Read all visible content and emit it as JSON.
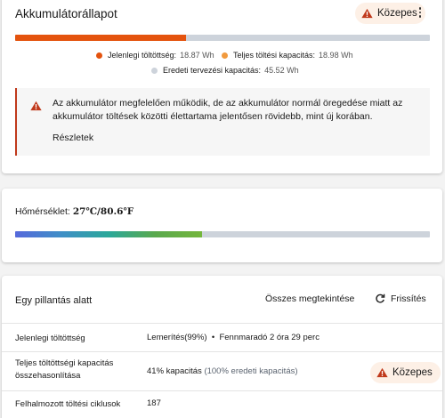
{
  "summary": {
    "title": "Akkumulátorállapot",
    "badge": "Közepes",
    "bar": {
      "level": 0.411,
      "fill_color": "#e4530e",
      "track_color": "#cdd3db"
    },
    "legend": [
      {
        "label": "Jelenlegi töltöttség:",
        "value": "18.87 Wh",
        "color": "#e4530e"
      },
      {
        "label": "Teljes töltési kapacitás:",
        "value": "18.98 Wh",
        "color": "#f19a3e"
      },
      {
        "label": "Eredeti tervezési kapacitás:",
        "value": "45.52 Wh",
        "color": "#cdd3db"
      }
    ],
    "alert": {
      "message": "Az akkumulátor megfelelően működik, de az akkumulátor normál öregedése miatt az akkumulátor töltések közötti élettartama jelentősen rövidebb, mint új korában.",
      "link": "Részletek"
    }
  },
  "temperature": {
    "label": "Hőmérséklet:",
    "value": "27℃/80.6℉",
    "bar_level": 0.45
  },
  "glance": {
    "title": "Egy pillantás alatt",
    "view_all": "Összes megtekintése",
    "refresh": "Frissítés",
    "rows": [
      {
        "label": "Jelenlegi töltöttség",
        "value": "Lemerítés(99%)  •  Fennmaradó 2 óra 29 perc"
      },
      {
        "label": "Teljes töltöttségi kapacitás összehasonlítása",
        "value": "41% kapacitás",
        "value_muted": "(100% eredeti kapacitás)",
        "badge": "Közepes"
      },
      {
        "label": "Felhalmozott töltési ciklusok",
        "value": "187"
      }
    ]
  },
  "colors": {
    "warning": "#c0391b",
    "badge_bg": "#fdf0e6"
  }
}
